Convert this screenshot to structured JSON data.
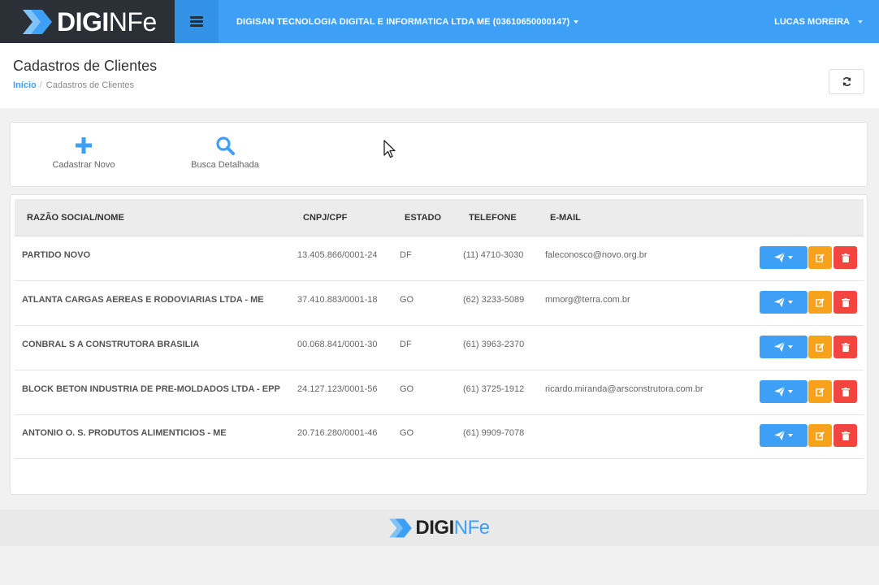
{
  "app": {
    "logo_bold": "DIGI",
    "logo_light": "NFe",
    "company": "DIGISAN TECNOLOGIA DIGITAL E INFORMATICA LTDA ME (03610650000147)",
    "user": "LUCAS MOREIRA"
  },
  "page": {
    "title": "Cadastros de Clientes",
    "breadcrumb_home": "Início",
    "breadcrumb_current": "Cadastros de Clientes"
  },
  "actions": {
    "new_label": "Cadastrar Novo",
    "search_label": "Busca Detalhada"
  },
  "table": {
    "headers": {
      "name": "RAZÃO SOCIAL/NOME",
      "doc": "CNPJ/CPF",
      "state": "ESTADO",
      "phone": "TELEFONE",
      "email": "E-MAIL"
    },
    "rows": [
      {
        "name": "PARTIDO NOVO",
        "doc": "13.405.866/0001-24",
        "state": "DF",
        "phone": "(11) 4710-3030",
        "email": "faleconosco@novo.org.br"
      },
      {
        "name": "ATLANTA CARGAS AEREAS E RODOVIARIAS LTDA - ME",
        "doc": "37.410.883/0001-18",
        "state": "GO",
        "phone": "(62) 3233-5089",
        "email": "mmorg@terra.com.br"
      },
      {
        "name": "CONBRAL S A CONSTRUTORA BRASILIA",
        "doc": "00.068.841/0001-30",
        "state": "DF",
        "phone": "(61) 3963-2370",
        "email": ""
      },
      {
        "name": "BLOCK BETON INDUSTRIA DE PRE-MOLDADOS LTDA - EPP",
        "doc": "24.127.123/0001-56",
        "state": "GO",
        "phone": "(61) 3725-1912",
        "email": "ricardo.miranda@arsconstrutora.com.br"
      },
      {
        "name": "ANTONIO O. S. PRODUTOS ALIMENTICIOS - ME",
        "doc": "20.716.280/0001-46",
        "state": "GO",
        "phone": "(61) 9909-7078",
        "email": ""
      }
    ],
    "row_buttons": {
      "send_icon": "paper-plane-icon",
      "edit_icon": "edit-icon",
      "delete_icon": "trash-icon"
    }
  },
  "colors": {
    "primary": "#3d9ff6",
    "brand_dark": "#2b2f36",
    "warning": "#f7a21b",
    "danger": "#f2453d"
  }
}
